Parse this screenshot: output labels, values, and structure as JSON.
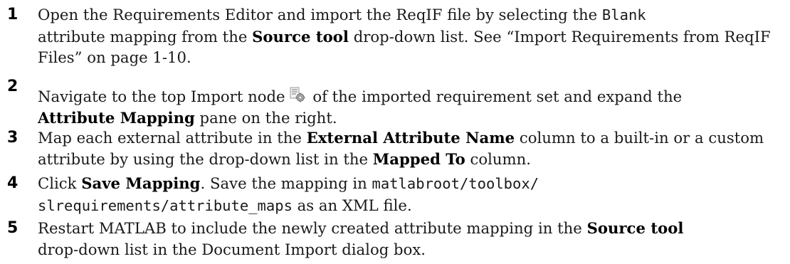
{
  "steps": [
    {
      "number": "1",
      "t1": "Open the Requirements Editor and import the ReqIF file by selecting the ",
      "code1": "Blank",
      "t2": " attribute mapping from the ",
      "bold1": "Source tool",
      "t3": " drop-down list. See “Import Requirements from ReqIF Files” on page 1-10."
    },
    {
      "number": "2",
      "t1": "Navigate to the top Import node",
      "icon": "import-node-icon",
      "t2": " of the imported requirement set and expand the ",
      "bold1": "Attribute Mapping",
      "t3": " pane on the right."
    },
    {
      "number": "3",
      "t1": "Map each external attribute in the ",
      "bold1": "External Attribute Name",
      "t2": " column to a built-in or a custom attribute by using the drop-down list in the ",
      "bold2": "Mapped To",
      "t3": " column."
    },
    {
      "number": "4",
      "t1": "Click ",
      "bold1": "Save Mapping",
      "t2": ". Save the mapping in ",
      "code1": "matlabroot/toolbox/",
      "code2": "slrequirements/attribute_maps",
      "t3": " as an XML file."
    },
    {
      "number": "5",
      "t1": "Restart MATLAB to include the newly created attribute mapping in the ",
      "bold1": "Source tool",
      "t2": " drop-down list in the Document Import dialog box."
    }
  ],
  "colors": {
    "text": "#1a1a1a",
    "icon_doc": "#c8c8c8",
    "icon_gear": "#8a8a8a"
  }
}
